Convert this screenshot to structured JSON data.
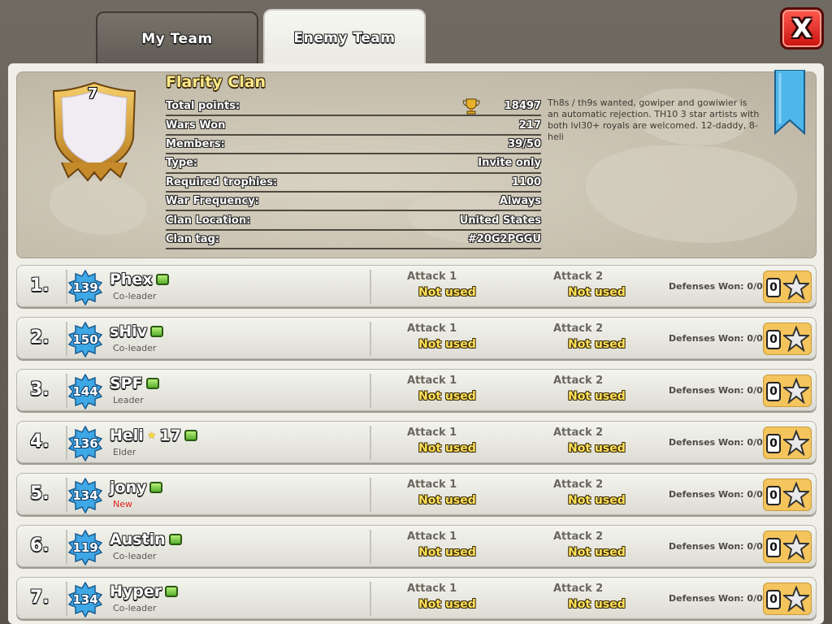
{
  "tabs": {
    "my_team": "My Team",
    "enemy_team": "Enemy Team"
  },
  "close_label": "X",
  "clan": {
    "level": "7",
    "name": "Flarity Clan",
    "stats": [
      {
        "label": "Total points:",
        "value": "18497"
      },
      {
        "label": "Wars Won",
        "value": "217"
      },
      {
        "label": "Members:",
        "value": "39/50"
      },
      {
        "label": "Type:",
        "value": "Invite only"
      },
      {
        "label": "Required trophies:",
        "value": "1100"
      },
      {
        "label": "War Frequency:",
        "value": "Always"
      },
      {
        "label": "Clan Location:",
        "value": "United States"
      },
      {
        "label": "Clan tag:",
        "value": "#20G2PGGU"
      }
    ],
    "description": "Th8s / th9s wanted, gowiper and gowiwier is an automatic rejection. TH10 3 star artists with both lvl30+ royals are welcomed. 12-daddy, 8-heli"
  },
  "labels": {
    "attack1": "Attack 1",
    "attack2": "Attack 2",
    "not_used": "Not used",
    "defenses": "Defenses Won: 0/0",
    "stars": "0"
  },
  "members": [
    {
      "rank": "1.",
      "level": "139",
      "name": "Phex",
      "role": "Co-leader",
      "new": false,
      "stars": ""
    },
    {
      "rank": "2.",
      "level": "150",
      "name": "sHiv",
      "role": "Co-leader",
      "new": false,
      "stars": ""
    },
    {
      "rank": "3.",
      "level": "144",
      "name": "SPF",
      "role": "Leader",
      "new": false,
      "stars": ""
    },
    {
      "rank": "4.",
      "level": "136",
      "name": "Heli",
      "role": "Elder",
      "new": false,
      "stars": "17"
    },
    {
      "rank": "5.",
      "level": "134",
      "name": "jony",
      "role": "New",
      "new": true,
      "stars": ""
    },
    {
      "rank": "6.",
      "level": "119",
      "name": "Austin",
      "role": "Co-leader",
      "new": false,
      "stars": ""
    },
    {
      "rank": "7.",
      "level": "134",
      "name": "Hyper",
      "role": "Co-leader",
      "new": false,
      "stars": ""
    }
  ],
  "colors": {
    "accent_gold": "#ffe25a",
    "xp_blue": "#3ea7e6",
    "close_red": "#d3120e"
  }
}
